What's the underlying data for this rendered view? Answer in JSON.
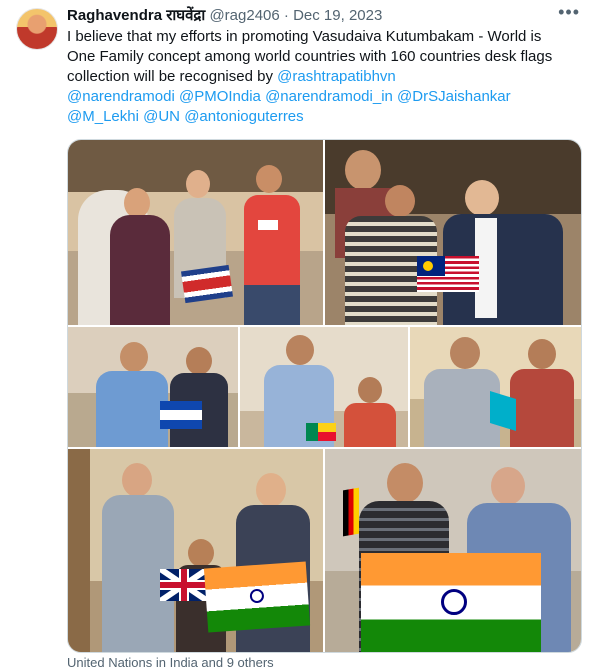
{
  "author": {
    "display_name": "Raghavendra राघवेंद्रा",
    "handle": "@rag2406",
    "separator": "·",
    "date": "Dec 19, 2023"
  },
  "more_icon": "more-horizontal-icon",
  "text": {
    "line1": "I believe that my efforts in promoting Vasudaiva Kutumbakam - World is",
    "line2": "One Family concept among world countries with 160 countries desk flags",
    "line3_prefix": "collection will be recognised by ",
    "mentions": [
      "@rashtrapatibhvn",
      "@narendramodi",
      "@PMOIndia",
      "@narendramodi_in",
      "@DrSJaishankar",
      "@M_Lekhi",
      "@UN",
      "@antonioguterres"
    ]
  },
  "media": {
    "photo_count": 7,
    "description_icons": [
      "costa-rica-flag",
      "malaysia-flag",
      "el-salvador-flag",
      "benin-flag",
      "kazakhstan-flag",
      "uk-flag",
      "india-flag",
      "germany-flag"
    ]
  },
  "tagged": "United Nations in India and 9 others",
  "colors": {
    "link": "#1d9bf0",
    "muted": "#536471",
    "border": "#cfd9de"
  }
}
